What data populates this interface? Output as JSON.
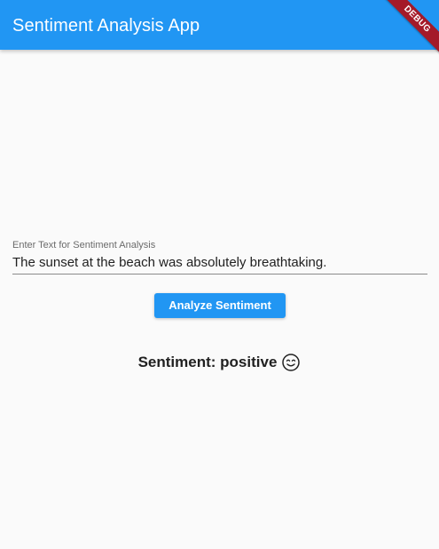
{
  "app_bar": {
    "title": "Sentiment Analysis App",
    "color": "#2196f3"
  },
  "debug_banner": {
    "label": "DEBUG",
    "color": "#a41a29"
  },
  "input": {
    "label": "Enter Text for Sentiment Analysis",
    "value": "The sunset at the beach was absolutely breathtaking."
  },
  "analyze_button": {
    "label": "Analyze Sentiment"
  },
  "result": {
    "text": "Sentiment: positive",
    "icon": "smiling-face-icon"
  }
}
